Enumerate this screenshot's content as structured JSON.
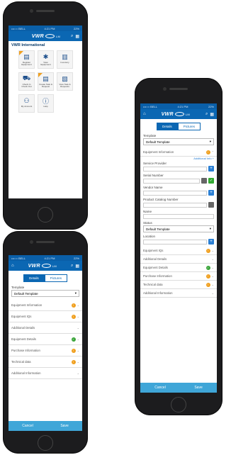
{
  "status": {
    "carrier": "•••○○ BELL",
    "time": "4:21 PM",
    "battery": "22%"
  },
  "nav": {
    "brand": "VWR",
    "suffix": "LM",
    "sub": "Part of Avantor",
    "home_icon": "home-icon",
    "search_icon": "search-icon",
    "scan_icon": "barcode-icon"
  },
  "home": {
    "org": "VWR International",
    "tiles": [
      {
        "label": "Register Equipment",
        "icon": "document-icon",
        "flag": true
      },
      {
        "label": "View Equipment",
        "icon": "gear-icon",
        "flag": false
      },
      {
        "label": "Inventory",
        "icon": "inventory-icon",
        "flag": false
      },
      {
        "label": "Check In Check Out",
        "icon": "cart-icon",
        "flag": false
      },
      {
        "label": "Create Task & Request",
        "icon": "task-icon",
        "flag": true
      },
      {
        "label": "View Task & Requests",
        "icon": "clipboard-icon",
        "flag": false
      },
      {
        "label": "My Account",
        "icon": "user-icon",
        "flag": false
      },
      {
        "label": "Help",
        "icon": "info-icon",
        "flag": false
      }
    ]
  },
  "form": {
    "tab_details": "Details",
    "tab_pictures": "Pictures",
    "template_label": "Template",
    "template_value": "Default Template",
    "sections": [
      {
        "label": "Equipment Information",
        "badge": "warn"
      },
      {
        "label": "Equipment IQs",
        "badge": "warn"
      },
      {
        "label": "Additional Details",
        "badge": ""
      },
      {
        "label": "Equipment Details",
        "badge": "ok"
      },
      {
        "label": "Purchase Information",
        "badge": "warn"
      },
      {
        "label": "Technical data",
        "badge": "warn"
      },
      {
        "label": "Additional Information",
        "badge": ""
      }
    ],
    "additional_info_link": "Additional Info +",
    "fields": {
      "service_provider": "Service Provider",
      "serial_number": "Serial Number",
      "vendor_name": "Vendor Name",
      "catalog_number": "Product Catalog Number",
      "name": "Name",
      "status": "Status",
      "status_value": "Default Template",
      "location": "Location"
    },
    "cancel": "Cancel",
    "save": "Save"
  },
  "colors": {
    "brand": "#0b67b3",
    "footer": "#3fa6d8",
    "warn": "#f0a020",
    "ok": "#3aa53a"
  }
}
